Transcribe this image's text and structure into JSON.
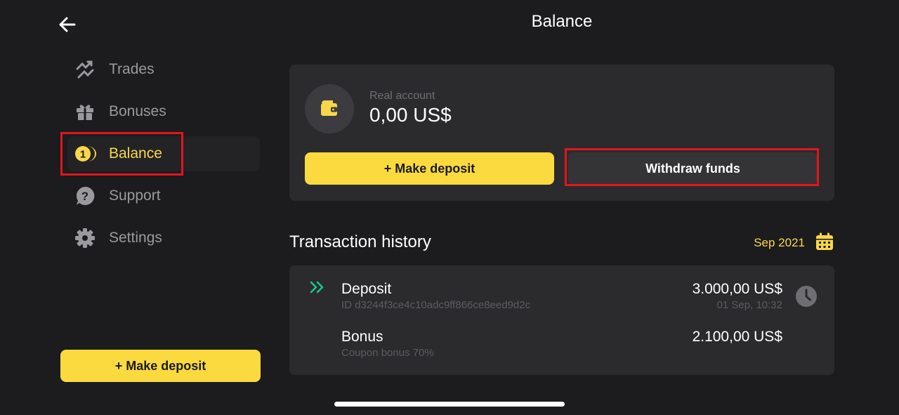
{
  "header": {
    "title": "Balance"
  },
  "sidebar": {
    "items": [
      {
        "label": "Trades",
        "icon": "trades-icon"
      },
      {
        "label": "Bonuses",
        "icon": "gift-icon"
      },
      {
        "label": "Balance",
        "icon": "balance-coin-icon",
        "active": true
      },
      {
        "label": "Support",
        "icon": "question-icon"
      },
      {
        "label": "Settings",
        "icon": "gear-icon"
      }
    ],
    "deposit_label": "+ Make deposit"
  },
  "account": {
    "type_label": "Real account",
    "balance": "0,00 US$",
    "deposit_label": "+ Make deposit",
    "withdraw_label": "Withdraw funds"
  },
  "history": {
    "title": "Transaction history",
    "month": "Sep 2021",
    "transactions": [
      {
        "title": "Deposit",
        "subtitle": "ID d3244f3ce4c10adc9ff866ce8eed9d2c",
        "amount": "3.000,00 US$",
        "date": "01 Sep, 10:32",
        "status_icon": "clock-icon"
      },
      {
        "title": "Bonus",
        "subtitle": "Coupon bonus 70%",
        "amount": "2.100,00 US$",
        "date": ""
      }
    ]
  },
  "colors": {
    "accent": "#fada3e",
    "background": "#1c1c1e",
    "card": "#2b2b2e",
    "highlight": "#e5141d",
    "deposit_icon": "#1fc48a"
  }
}
